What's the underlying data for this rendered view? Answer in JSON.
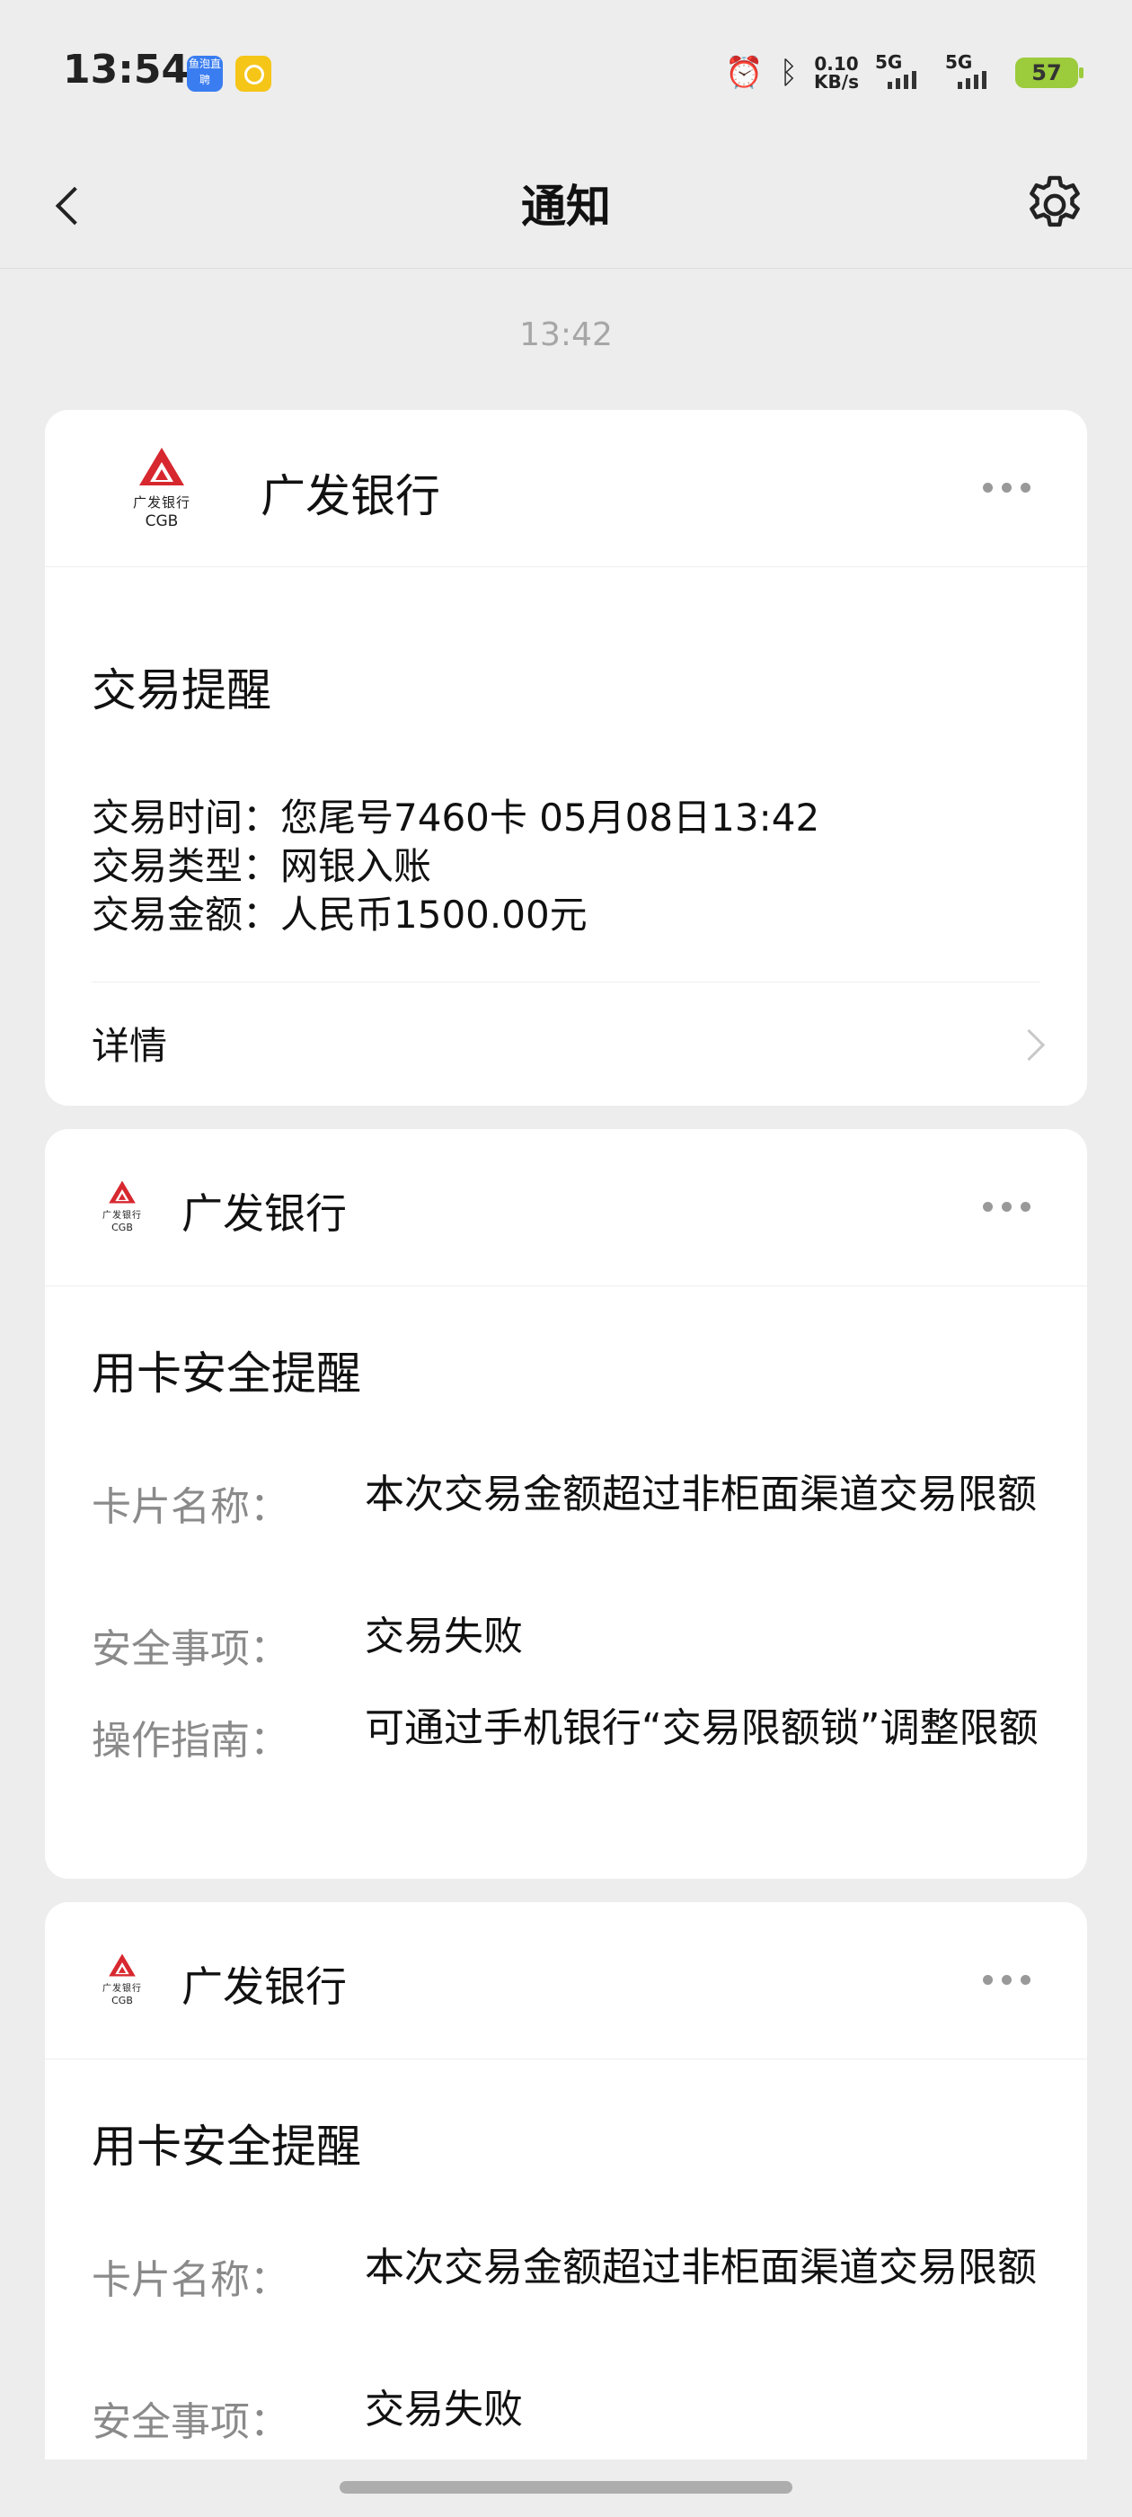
{
  "status_bar": {
    "time": "13:54",
    "badge_app": "鱼泡直聘",
    "net_speed_value": "0.10",
    "net_speed_unit": "KB/s",
    "signal_1": "5G",
    "signal_2": "5G",
    "battery": "57"
  },
  "header": {
    "title": "通知"
  },
  "timestamp": "13:42",
  "cards": [
    {
      "bank_name": "广发银行",
      "logo_cn": "广发银行",
      "logo_en": "CGB",
      "title": "交易提醒",
      "lines": [
        "交易时间：您尾号7460卡 05月08日13:42",
        "交易类型：网银入账",
        "交易金额：人民币1500.00元"
      ],
      "detail_label": "详情"
    },
    {
      "bank_name": "广发银行",
      "logo_cn": "广发银行",
      "logo_en": "CGB",
      "title": "用卡安全提醒",
      "fields": [
        {
          "key": "卡片名称：",
          "value": "本次交易金额超过非柜面渠道交易限额"
        },
        {
          "key": "安全事项：",
          "value": "交易失败"
        },
        {
          "key": "操作指南：",
          "value": "可通过手机银行“交易限额锁”调整限额"
        }
      ]
    },
    {
      "bank_name": "广发银行",
      "logo_cn": "广发银行",
      "logo_en": "CGB",
      "title": "用卡安全提醒",
      "fields": [
        {
          "key": "卡片名称：",
          "value": "本次交易金额超过非柜面渠道交易限额"
        },
        {
          "key": "安全事项：",
          "value": "交易失败"
        }
      ]
    }
  ],
  "colors": {
    "background": "#EDEDED",
    "card": "#FFFFFF",
    "brand_red": "#D7282F",
    "muted_text": "#8A8A8A"
  }
}
